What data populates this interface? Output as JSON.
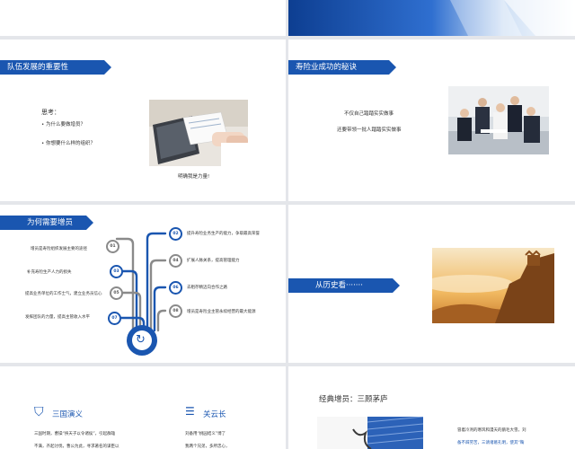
{
  "slide2": {
    "banner": "队伍发展的重要性",
    "think_label": "思考：",
    "questions": [
      "为什么要做增员？",
      "你想要什么样的组织？"
    ],
    "caption": "明确我是力量!"
  },
  "slide3": {
    "banner": "寿险业成功的秘诀",
    "lines": [
      "不仅自己踏踏实实做事",
      "还要带领一批人踏踏实实做事"
    ]
  },
  "slide4": {
    "banner": "为何需要增员",
    "left_items": [
      {
        "num": "01",
        "text": "增员是寿险组织发展主要的途径"
      },
      {
        "num": "03",
        "text": "补充寿险生产人力的损失"
      },
      {
        "num": "05",
        "text": "提高业务单位的工作士气，建立业务员信心"
      },
      {
        "num": "07",
        "text": "发挥团队的力量，提高主管收入水平"
      }
    ],
    "right_items": [
      {
        "num": "02",
        "text": "提升寿险业务生产的能力，争取最高荣誉"
      },
      {
        "num": "04",
        "text": "扩展人脉关系，提高管理能力"
      },
      {
        "num": "06",
        "text": "去粗存精迈向合作之路"
      },
      {
        "num": "08",
        "text": "增员是寿险业主管永续经营的最大能源"
      }
    ]
  },
  "slide5": {
    "banner": "从历史看·······"
  },
  "slide6": {
    "col1_title": "三国演义",
    "col1_lines": [
      "三国时期，曹操“挟天子以令诸侯”，引起群雄",
      "不满，齐起讨伐，曹公为此，寻求著名的谋臣以"
    ],
    "col2_title": "关云长",
    "col2_lines": [
      "刘备用“桃园结义”博了",
      "我两个兄弟，多所忠心，"
    ]
  },
  "slide7": {
    "title": "经典增员：三顾茅庐",
    "lines": [
      "冒着冷冽的寒风和漫天的鹅毛大雪，刘",
      "备不辞劳苦，三请诸葛孔明，使其“鞠"
    ]
  },
  "colors": {
    "brand_blue": "#1a56b0",
    "background": "#e4e6ea"
  }
}
